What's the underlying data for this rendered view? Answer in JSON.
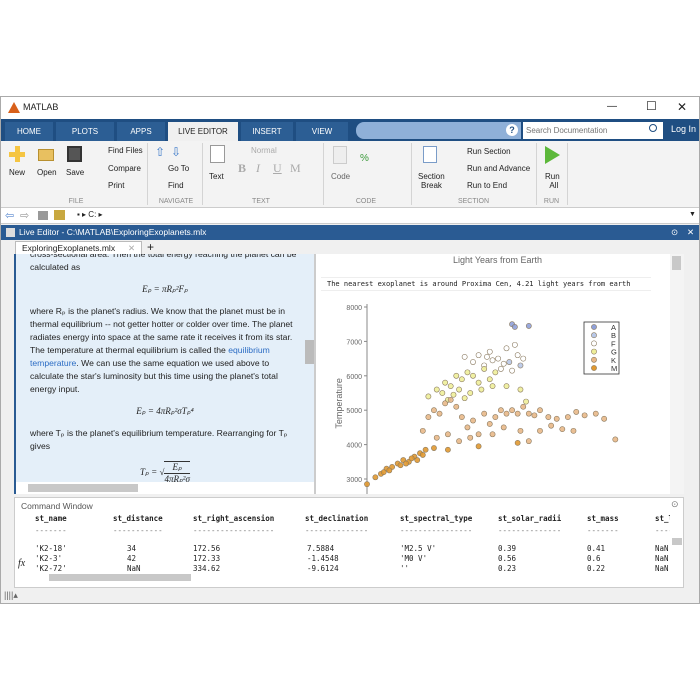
{
  "window": {
    "title": "MATLAB",
    "minimize": "—",
    "maximize": "☐",
    "close": "✕"
  },
  "tabs": [
    "HOME",
    "PLOTS",
    "APPS",
    "LIVE EDITOR",
    "INSERT",
    "VIEW"
  ],
  "search": {
    "placeholder": "Search Documentation"
  },
  "login": "Log In",
  "ribbon": {
    "file": {
      "new": "New",
      "open": "Open",
      "save": "Save",
      "find_files": "Find Files",
      "compare": "Compare",
      "print": "Print",
      "label": "FILE"
    },
    "navigate": {
      "go_to": "Go To",
      "find": "Find",
      "label": "NAVIGATE"
    },
    "text": {
      "text": "Text",
      "style": "Normal",
      "label": "TEXT",
      "bold": "B",
      "italic": "I",
      "underline": "U",
      "mono": "M"
    },
    "code": {
      "code": "Code",
      "label": "CODE"
    },
    "section": {
      "section_break_1": "Section",
      "section_break_2": "Break",
      "run_section": "Run Section",
      "run_and_advance": "Run and Advance",
      "run_to_end": "Run to End",
      "label": "SECTION"
    },
    "run": {
      "run_1": "Run",
      "run_2": "All",
      "label": "RUN"
    }
  },
  "address": {
    "path": "C:"
  },
  "live_editor": {
    "title": "Live Editor - C:\\MATLAB\\ExploringExoplanets.mlx",
    "doc_tab": "ExploringExoplanets.mlx",
    "add_tab": "+"
  },
  "document": {
    "p1": "cross-sectional area.  Then the total energy reaching the planet can be calculated as",
    "eq1": "Eₚ = πRₚ²Fₚ",
    "p2a": "where Rₚ is the planet's radius.  We know that the planet must be in thermal equilibrium -- not getter hotter or colder over time.  The planet radiates energy into space at the same rate it receives it from its star. The temperature at thermal equilibrium is called the ",
    "p2link": "equilibrium temperature",
    "p2b": ".  We can use the same equation we used above to calculate the star's luminosity but this time using the planet's total energy input.",
    "eq2": "Eₚ = 4πRₚ²σTₚ⁴",
    "p3": "where Tₚ is the planet's equilibrium temperature.  Rearranging for Tₚ gives",
    "eq3_lhs": "Tₚ = ",
    "eq3_num": "Eₚ",
    "eq3_den": "4πRₚ²σ"
  },
  "output": {
    "prev_xlabel": "Light Years from Earth",
    "message": "The nearest exoplanet is around Proxima Cen, 4.21 light years from earth"
  },
  "chart_data": {
    "type": "scatter",
    "ylabel": "Temperature",
    "yticks": [
      3000,
      4000,
      5000,
      6000,
      7000,
      8000
    ],
    "ylim": [
      2800,
      8000
    ],
    "xlim": [
      0,
      100
    ],
    "legend": [
      "A",
      "B",
      "F",
      "G",
      "K",
      "M"
    ],
    "legend_position": "top-right",
    "colors": {
      "A": "#8fa0d8",
      "B": "#b8c8e8",
      "F": "#ffffff",
      "G": "#eeee99",
      "K": "#e8b888",
      "M": "#e09830"
    },
    "series": [
      {
        "name": "A",
        "points": [
          [
            52,
            7500
          ],
          [
            53,
            7420
          ],
          [
            58,
            7450
          ]
        ]
      },
      {
        "name": "B",
        "points": [
          [
            51,
            6400
          ],
          [
            55,
            6300
          ]
        ]
      },
      {
        "name": "F",
        "points": [
          [
            35,
            6550
          ],
          [
            40,
            6600
          ],
          [
            44,
            6700
          ],
          [
            47,
            6500
          ],
          [
            50,
            6800
          ],
          [
            53,
            6900
          ],
          [
            56,
            6500
          ],
          [
            42,
            6300
          ],
          [
            48,
            6200
          ],
          [
            52,
            6150
          ],
          [
            38,
            6400
          ],
          [
            45,
            6450
          ],
          [
            54,
            6600
          ],
          [
            49,
            6350
          ],
          [
            43,
            6550
          ]
        ]
      },
      {
        "name": "G",
        "points": [
          [
            22,
            5400
          ],
          [
            25,
            5600
          ],
          [
            28,
            5800
          ],
          [
            30,
            5700
          ],
          [
            32,
            6000
          ],
          [
            34,
            5900
          ],
          [
            36,
            6100
          ],
          [
            38,
            6000
          ],
          [
            40,
            5800
          ],
          [
            42,
            6200
          ],
          [
            44,
            5900
          ],
          [
            46,
            6100
          ],
          [
            27,
            5500
          ],
          [
            29,
            5300
          ],
          [
            33,
            5600
          ],
          [
            37,
            5500
          ],
          [
            41,
            5600
          ],
          [
            35,
            5350
          ],
          [
            31,
            5450
          ],
          [
            45,
            5700
          ],
          [
            50,
            5700
          ],
          [
            55,
            5600
          ],
          [
            57,
            5250
          ]
        ]
      },
      {
        "name": "K",
        "points": [
          [
            20,
            4400
          ],
          [
            22,
            4800
          ],
          [
            24,
            5000
          ],
          [
            26,
            4900
          ],
          [
            28,
            5200
          ],
          [
            30,
            5300
          ],
          [
            32,
            5100
          ],
          [
            34,
            4800
          ],
          [
            36,
            4500
          ],
          [
            38,
            4700
          ],
          [
            40,
            4300
          ],
          [
            42,
            4900
          ],
          [
            44,
            4600
          ],
          [
            46,
            4800
          ],
          [
            48,
            5000
          ],
          [
            50,
            4900
          ],
          [
            52,
            5000
          ],
          [
            54,
            4900
          ],
          [
            56,
            5100
          ],
          [
            58,
            4900
          ],
          [
            60,
            4850
          ],
          [
            62,
            5000
          ],
          [
            65,
            4800
          ],
          [
            68,
            4750
          ],
          [
            72,
            4800
          ],
          [
            75,
            4950
          ],
          [
            78,
            4850
          ],
          [
            82,
            4900
          ],
          [
            85,
            4750
          ],
          [
            89,
            4150
          ],
          [
            25,
            4200
          ],
          [
            29,
            4300
          ],
          [
            33,
            4100
          ],
          [
            37,
            4200
          ],
          [
            45,
            4300
          ],
          [
            49,
            4500
          ],
          [
            55,
            4400
          ],
          [
            58,
            4100
          ],
          [
            62,
            4400
          ],
          [
            66,
            4550
          ],
          [
            70,
            4450
          ],
          [
            74,
            4400
          ]
        ]
      },
      {
        "name": "M",
        "points": [
          [
            0,
            2850
          ],
          [
            3,
            3050
          ],
          [
            5,
            3150
          ],
          [
            7,
            3300
          ],
          [
            9,
            3350
          ],
          [
            11,
            3450
          ],
          [
            13,
            3550
          ],
          [
            15,
            3500
          ],
          [
            17,
            3650
          ],
          [
            19,
            3750
          ],
          [
            21,
            3850
          ],
          [
            24,
            3900
          ],
          [
            8,
            3250
          ],
          [
            12,
            3400
          ],
          [
            16,
            3600
          ],
          [
            20,
            3700
          ],
          [
            6,
            3200
          ],
          [
            14,
            3450
          ],
          [
            18,
            3550
          ],
          [
            29,
            3850
          ],
          [
            40,
            3950
          ],
          [
            54,
            4050
          ]
        ]
      }
    ]
  },
  "command_window": {
    "title": "Command Window",
    "headers": [
      "st_name",
      "st_distance",
      "st_right_ascension",
      "st_declination",
      "st_spectral_type",
      "st_solar_radii",
      "st_mass",
      "st_lum"
    ],
    "rows": [
      [
        "'K2-18'",
        "34",
        "172.56",
        "7.5884",
        "'M2.5 V'",
        "0.39",
        "0.41",
        "NaN"
      ],
      [
        "'K2-3'",
        "42",
        "172.33",
        "-1.4548",
        "'M0 V'",
        "0.56",
        "0.6",
        "NaN"
      ],
      [
        "'K2-72'",
        "NaN",
        "334.62",
        "-9.6124",
        "''",
        "0.23",
        "0.22",
        "NaN"
      ]
    ],
    "prompt": "fx"
  }
}
